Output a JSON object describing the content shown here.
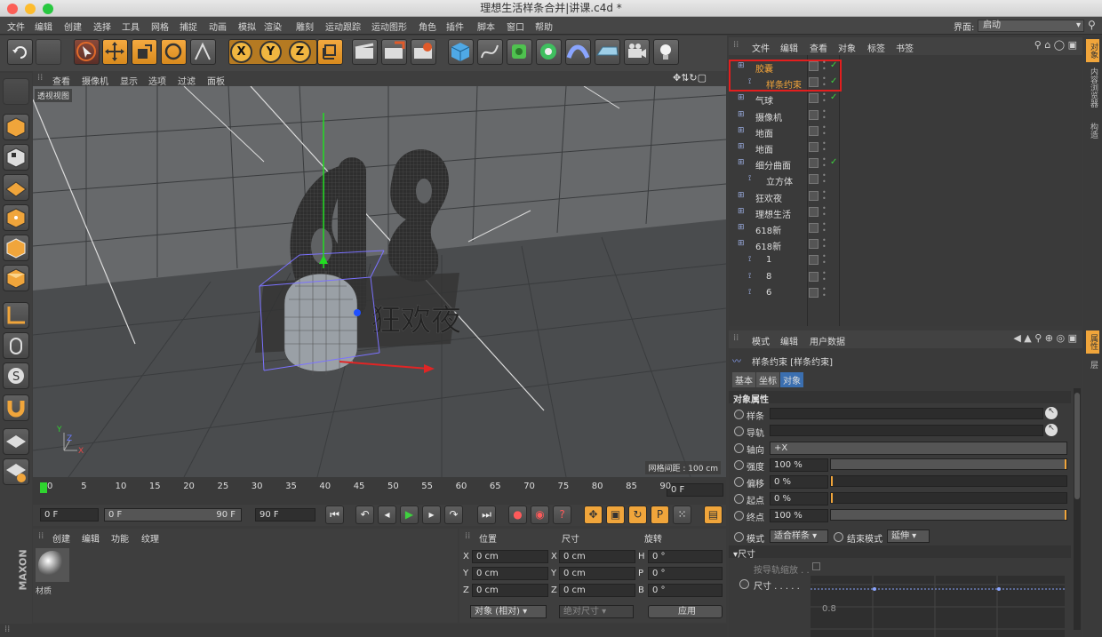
{
  "window": {
    "title": "理想生活样条合并|讲课.c4d *"
  },
  "menu": [
    "文件",
    "编辑",
    "创建",
    "选择",
    "工具",
    "网格",
    "捕捉",
    "动画",
    "模拟",
    "渲染",
    "雕刻",
    "运动跟踪",
    "运动图形",
    "角色",
    "插件",
    "脚本",
    "窗口",
    "帮助"
  ],
  "interface": {
    "label": "界面:",
    "value": "启动"
  },
  "toolbar": {
    "x": "X",
    "y": "Y",
    "z": "Z"
  },
  "viewport": {
    "menu": [
      "查看",
      "摄像机",
      "显示",
      "选项",
      "过滤",
      "面板"
    ],
    "view_name": "透视视图",
    "grid_spacing": "网格间距 : 100 cm",
    "axis_y": "Y",
    "axis_z": "Z",
    "axis_x": "X"
  },
  "timeline": {
    "ticks": [
      "0",
      "5",
      "10",
      "15",
      "20",
      "25",
      "30",
      "35",
      "40",
      "45",
      "50",
      "55",
      "60",
      "65",
      "70",
      "75",
      "80",
      "85",
      "90"
    ],
    "current": "0 F",
    "start": "0 F",
    "range_start": "0 F",
    "range_end": "90 F",
    "end": "90 F"
  },
  "material": {
    "menu": [
      "创建",
      "编辑",
      "功能",
      "纹理"
    ],
    "item": "材质"
  },
  "coords": {
    "headers": [
      "位置",
      "尺寸",
      "旋转"
    ],
    "rows": [
      {
        "a": "X",
        "av": "0 cm",
        "b": "X",
        "bv": "0 cm",
        "c": "H",
        "cv": "0 °"
      },
      {
        "a": "Y",
        "av": "0 cm",
        "b": "Y",
        "bv": "0 cm",
        "c": "P",
        "cv": "0 °"
      },
      {
        "a": "Z",
        "av": "0 cm",
        "b": "Z",
        "bv": "0 cm",
        "c": "B",
        "cv": "0 °"
      }
    ],
    "mode": "对象 (相对)",
    "size_mode": "绝对尺寸",
    "apply": "应用"
  },
  "object_manager": {
    "menu": [
      "文件",
      "编辑",
      "查看",
      "对象",
      "标签",
      "书签"
    ],
    "objects": [
      {
        "name": "胶囊",
        "indent": 0,
        "highlight": true
      },
      {
        "name": "样条约束",
        "indent": 1,
        "highlight": true
      },
      {
        "name": "气球",
        "indent": 0
      },
      {
        "name": "摄像机",
        "indent": 0
      },
      {
        "name": "地面",
        "indent": 0
      },
      {
        "name": "地面",
        "indent": 0
      },
      {
        "name": "细分曲面",
        "indent": 0
      },
      {
        "name": "立方体",
        "indent": 1
      },
      {
        "name": "狂欢夜",
        "indent": 0
      },
      {
        "name": "理想生活",
        "indent": 0
      },
      {
        "name": "618新",
        "indent": 0
      },
      {
        "name": "618新",
        "indent": 0
      },
      {
        "name": "1",
        "indent": 1
      },
      {
        "name": "8",
        "indent": 1
      },
      {
        "name": "6",
        "indent": 1
      }
    ]
  },
  "attributes": {
    "menu": [
      "模式",
      "编辑",
      "用户数据"
    ],
    "title": "样条约束 [样条约束]",
    "tabs": [
      "基本",
      "坐标",
      "对象"
    ],
    "section": "对象属性",
    "fields": [
      {
        "label": "样条",
        "value": ""
      },
      {
        "label": "导轨",
        "value": ""
      },
      {
        "label": "轴向",
        "value": "+X"
      },
      {
        "label": "强度",
        "value": "100 %",
        "fill": 1.0
      },
      {
        "label": "偏移",
        "value": "0 %",
        "fill": 0.0
      },
      {
        "label": "起点",
        "value": "0 %",
        "fill": 0.0
      },
      {
        "label": "终点",
        "value": "100 %",
        "fill": 1.0
      }
    ],
    "mode_label": "模式",
    "mode_value": "适合样条",
    "end_mode_label": "结束模式",
    "end_mode_value": "延伸",
    "size_section": "尺寸",
    "rail_scale": "按导轨缩放 . .",
    "size_label": "尺寸 . . . . .",
    "graph_value": "0.8"
  },
  "right_tabs": [
    "对象",
    "内容浏览器",
    "构造"
  ],
  "right_tabs2": [
    "属性",
    "层"
  ]
}
